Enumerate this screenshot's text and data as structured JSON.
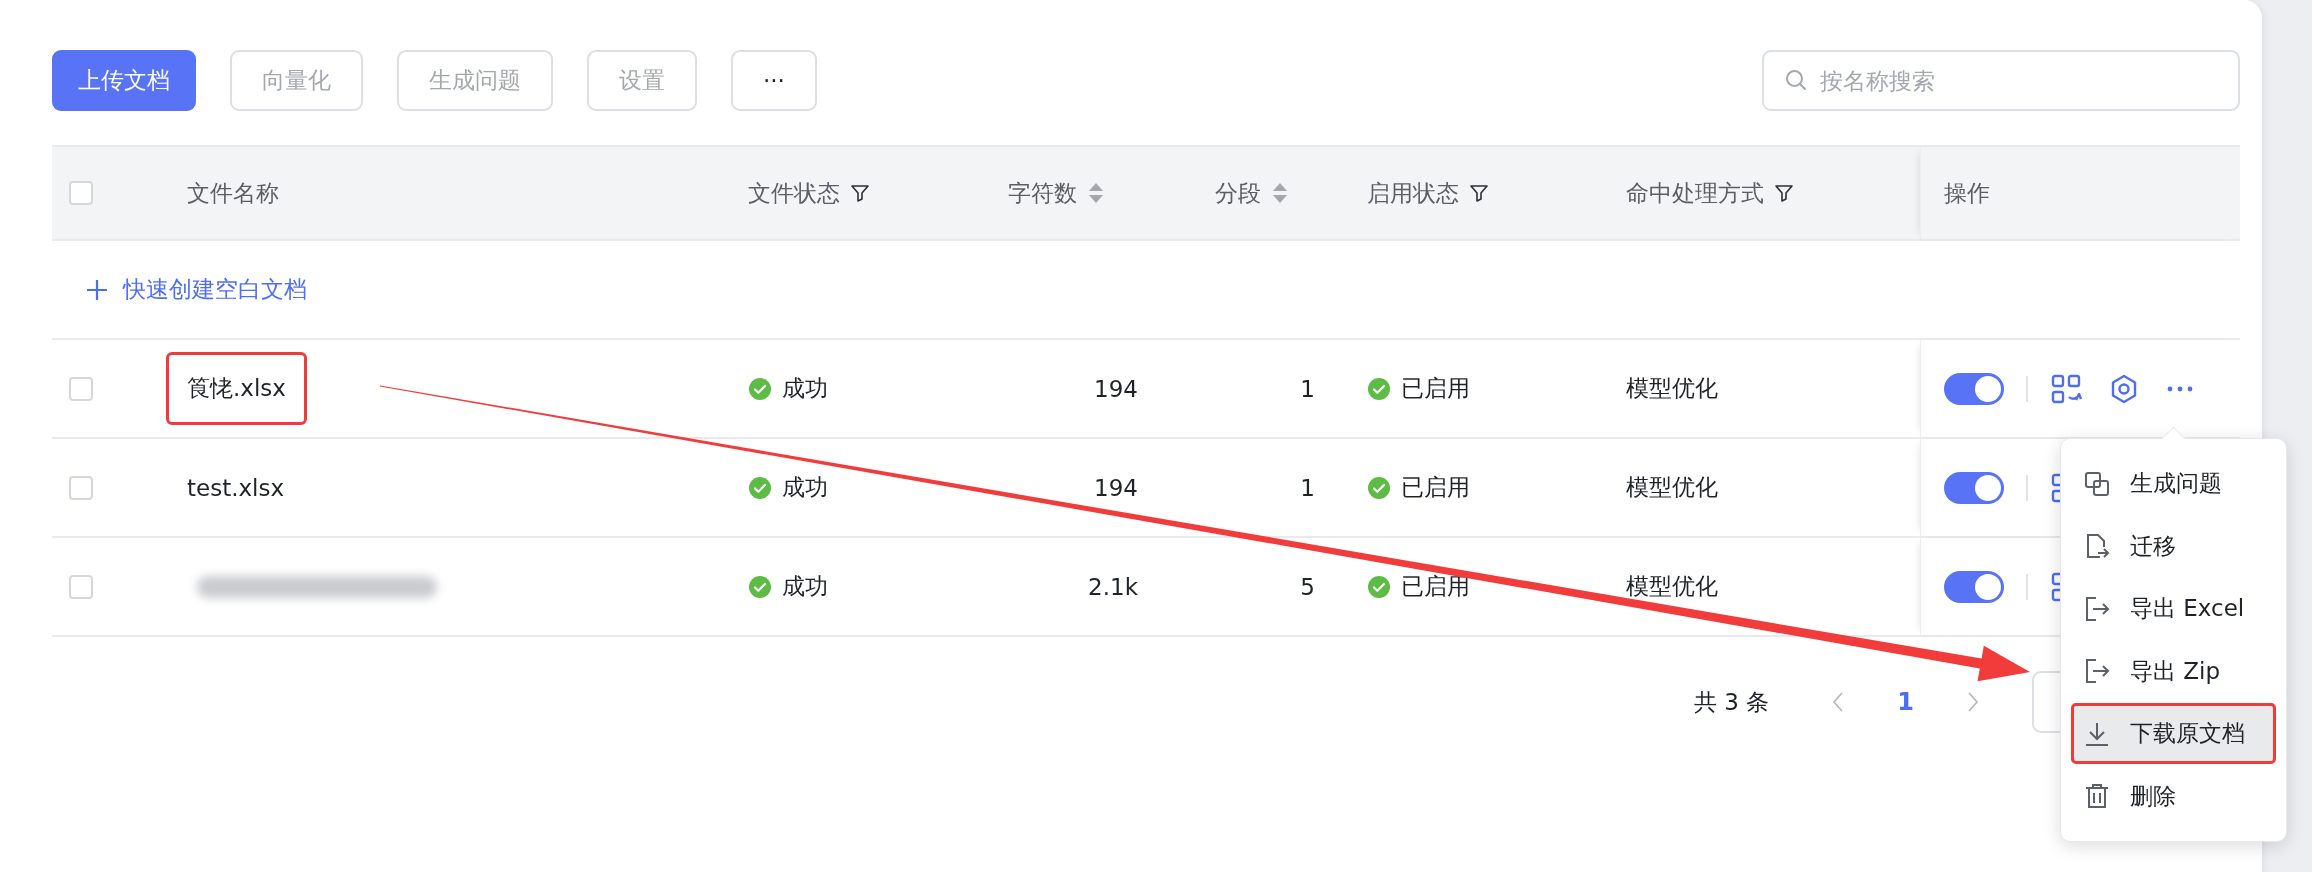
{
  "toolbar": {
    "buttons": [
      {
        "label": "上传文档",
        "kind": "primary",
        "disabled": false
      },
      {
        "label": "向量化",
        "kind": "default",
        "disabled": true
      },
      {
        "label": "生成问题",
        "kind": "default",
        "disabled": true
      },
      {
        "label": "设置",
        "kind": "default",
        "disabled": true
      },
      {
        "label": "···",
        "kind": "default",
        "disabled": false
      }
    ]
  },
  "search": {
    "placeholder": "按名称搜索"
  },
  "table": {
    "select_all": {
      "checked": false
    },
    "columns": [
      {
        "label": "文件名称",
        "filter": false,
        "sort": false
      },
      {
        "label": "文件状态",
        "filter": true,
        "sort": false
      },
      {
        "label": "字符数",
        "filter": false,
        "sort": true
      },
      {
        "label": "分段",
        "filter": false,
        "sort": true
      },
      {
        "label": "启用状态",
        "filter": true,
        "sort": false
      },
      {
        "label": "命中处理方式",
        "filter": true,
        "sort": false
      },
      {
        "label": "操作",
        "filter": false,
        "sort": false
      }
    ],
    "quick_create": "快速创建空白文档",
    "rows": [
      {
        "checked": false,
        "name": "筤恅.xlsx",
        "redacted": false,
        "highlighted": true,
        "status": "成功",
        "chars": "194",
        "segments": "1",
        "enabled_label": "已启用",
        "enabled": true,
        "mode": "模型优化",
        "actions": [
          {
            "kind": "swap"
          },
          {
            "kind": "settings"
          },
          {
            "kind": "more"
          }
        ]
      },
      {
        "checked": false,
        "name": "test.xlsx",
        "redacted": false,
        "highlighted": false,
        "status": "成功",
        "chars": "194",
        "segments": "1",
        "enabled_label": "已启用",
        "enabled": true,
        "mode": "模型优化",
        "actions": [
          {
            "kind": "swap"
          }
        ]
      },
      {
        "checked": false,
        "redacted": true,
        "highlighted": false,
        "status": "成功",
        "chars": "2.1k",
        "segments": "5",
        "enabled_label": "已启用",
        "enabled": true,
        "mode": "模型优化",
        "actions": [
          {
            "kind": "swap"
          }
        ]
      }
    ]
  },
  "pagination": {
    "total": "共 3 条",
    "pages": [
      {
        "label": "1",
        "selected": true
      }
    ]
  },
  "menu": {
    "items": [
      {
        "label": "生成问题",
        "kind": "copy",
        "highlighted": false
      },
      {
        "label": "迁移",
        "kind": "migrate",
        "highlighted": false
      },
      {
        "label": "导出 Excel",
        "kind": "export",
        "highlighted": false
      },
      {
        "label": "导出 Zip",
        "kind": "export",
        "highlighted": false
      },
      {
        "label": "下载原文档",
        "kind": "download",
        "highlighted": true
      },
      {
        "label": "删除",
        "kind": "trash",
        "highlighted": false
      }
    ]
  }
}
